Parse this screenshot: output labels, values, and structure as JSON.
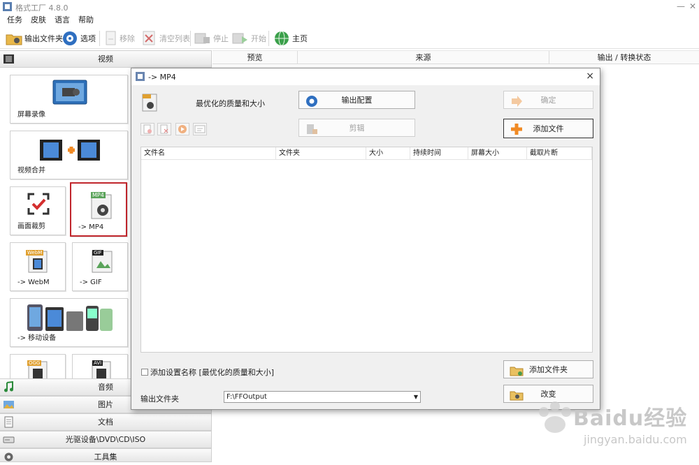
{
  "window": {
    "title": "格式工厂 4.8.0",
    "min": "—",
    "close": "✕"
  },
  "menu": [
    "任务",
    "皮肤",
    "语言",
    "帮助"
  ],
  "toolbar": {
    "output_folder": "输出文件夹",
    "options": "选项",
    "remove": "移除",
    "clear_list": "清空列表",
    "stop": "停止",
    "start": "开始",
    "home": "主页"
  },
  "categories": {
    "video": "视频",
    "audio": "音频",
    "image": "图片",
    "document": "文档",
    "disc": "光驱设备\\DVD\\CD\\ISO",
    "tools": "工具集"
  },
  "video_tiles": {
    "screen_record": "屏幕录像",
    "video_join": "视频合并",
    "crop": "画面裁剪",
    "to_mp4": "-> MP4",
    "to_webm": "-> WebM",
    "to_gif": "-> GIF",
    "to_mobile": "-> 移动设备",
    "badge_mp4": "MP4",
    "badge_gif": "GIF",
    "badge_avi": "AVI",
    "badge_ogg": "OGG",
    "badge_webm": "WebM"
  },
  "main_table": {
    "columns": [
      "预览",
      "来源",
      "输出 / 转换状态"
    ]
  },
  "dialog": {
    "title": "-> MP4",
    "profile_name": "最优化的质量和大小",
    "output_config": "输出配置",
    "ok": "确定",
    "clip": "剪辑",
    "add_file": "添加文件",
    "add_folder": "添加文件夹",
    "change": "改变",
    "file_columns": [
      "文件名",
      "文件夹",
      "大小",
      "持续时间",
      "屏幕大小",
      "截取片断"
    ],
    "checkbox_label": "添加设置名称 [最优化的质量和大小]",
    "output_folder_label": "输出文件夹",
    "output_folder_value": "F:\\FFOutput",
    "close": "×"
  },
  "watermark": {
    "brand": "Baidu经验",
    "url": "jingyan.baidu.com"
  },
  "colors": {
    "selected_border": "#c0262c",
    "accent_orange": "#f08a24"
  }
}
